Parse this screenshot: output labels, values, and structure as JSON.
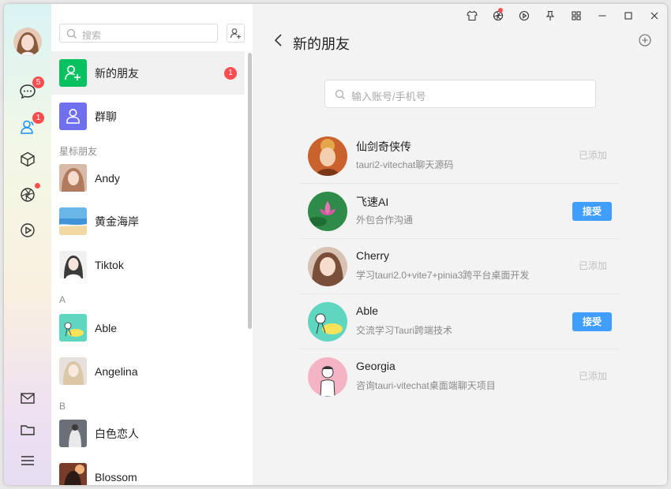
{
  "rail": {
    "badges": {
      "chat": "5",
      "contacts": "1"
    }
  },
  "list": {
    "search_placeholder": "搜索",
    "items": [
      {
        "label": "新的朋友",
        "count": "1"
      },
      {
        "label": "群聊"
      }
    ],
    "sections": {
      "starred": "星标朋友",
      "a": "A",
      "b": "B"
    },
    "contacts": [
      {
        "name": "Andy"
      },
      {
        "name": "黄金海岸"
      },
      {
        "name": "Tiktok"
      },
      {
        "name": "Able"
      },
      {
        "name": "Angelina"
      },
      {
        "name": "白色恋人"
      },
      {
        "name": "Blossom"
      }
    ]
  },
  "main": {
    "title": "新的朋友",
    "search_placeholder": "输入账号/手机号",
    "requests": [
      {
        "name": "仙剑奇侠传",
        "desc": "tauri2-vitechat聊天源码",
        "status": "已添加"
      },
      {
        "name": "飞速AI",
        "desc": "外包合作沟通",
        "status": "接受"
      },
      {
        "name": "Cherry",
        "desc": "学习tauri2.0+vite7+pinia3跨平台桌面开发",
        "status": "已添加"
      },
      {
        "name": "Able",
        "desc": "交流学习Tauri跨端技术",
        "status": "接受"
      },
      {
        "name": "Georgia",
        "desc": "咨询tauri-vitechat桌面端聊天项目",
        "status": "已添加"
      }
    ]
  },
  "colors": {
    "accent": "#409eff",
    "badge": "#ff4d4f",
    "green": "#07c160",
    "purple": "#6f6ff0"
  }
}
